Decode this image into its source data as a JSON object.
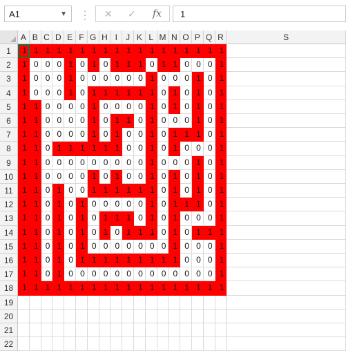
{
  "name_box": {
    "value": "A1"
  },
  "formula_bar": {
    "cancel_icon": "x-icon",
    "enter_icon": "check-icon",
    "function_label": "fx",
    "value": "1"
  },
  "columns": [
    "A",
    "B",
    "C",
    "D",
    "E",
    "F",
    "G",
    "H",
    "I",
    "J",
    "K",
    "L",
    "M",
    "N",
    "O",
    "P",
    "Q",
    "R",
    "S"
  ],
  "rows": [
    "1",
    "2",
    "3",
    "4",
    "5",
    "6",
    "7",
    "8",
    "9",
    "10",
    "11",
    "12",
    "13",
    "14",
    "15",
    "16",
    "17",
    "18",
    "19",
    "20",
    "21",
    "22"
  ],
  "colors": {
    "wall": "#ff0000",
    "path": "#ffffff",
    "header_bg": "#f3f3f3",
    "gridline": "#dadada"
  },
  "maze": [
    "111111111111111111",
    "100010101110110001",
    "100010000001000101",
    "100010111111010101",
    "110000100001010101",
    "110000101101000101",
    "110000101001011101",
    "110111111001010001",
    "110000000001000101",
    "110000101001010101",
    "110100111111010101",
    "110101000001011101",
    "110101011101010001",
    "110101010111010111",
    "110101000000010001",
    "110101111111110001",
    "110100000000000001",
    "111111111111111111"
  ]
}
